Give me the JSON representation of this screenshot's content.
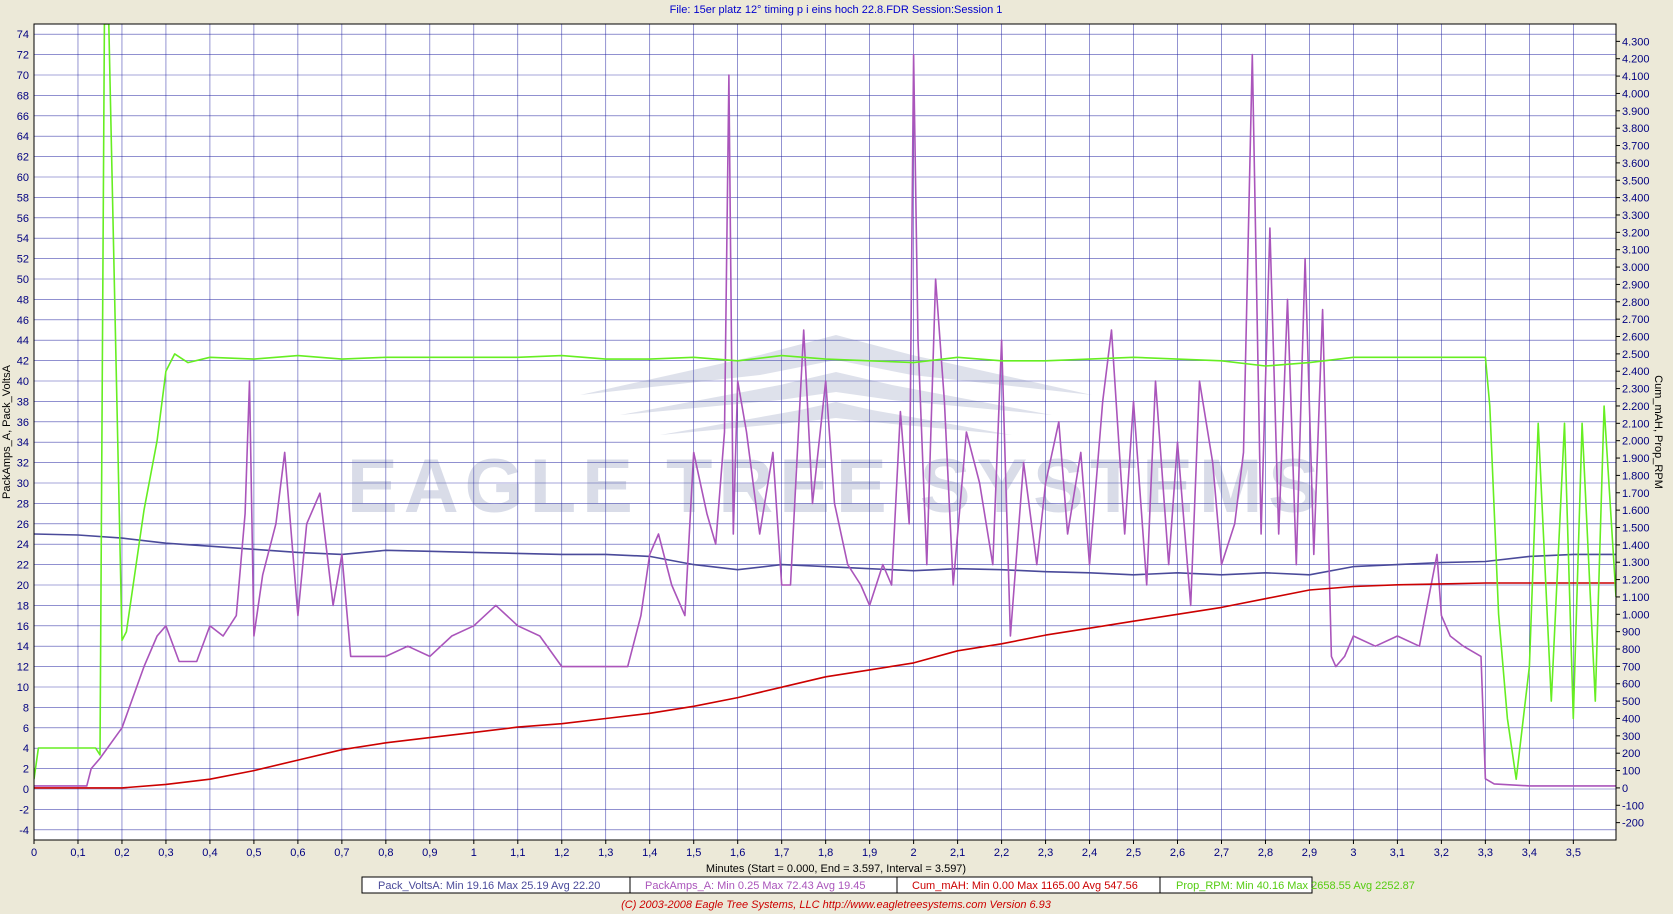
{
  "chart_data": {
    "type": "line",
    "title": "File: 15er platz 12° timing p i eins hoch 22.8.FDR   Session:Session 1",
    "xlabel": "Minutes (Start = 0.000,  End = 3.597,  Interval =  3.597)",
    "ylabel_left": "PackAmps_A, Pack_VoltsA",
    "ylabel_right": "Cum_mAH, Prop_RPM",
    "xlim": [
      0,
      3.597
    ],
    "ylim_left": [
      -5,
      75
    ],
    "ylim_right": [
      -300,
      4400
    ],
    "x_ticks": [
      0,
      0.1,
      0.2,
      0.3,
      0.4,
      0.5,
      0.6,
      0.7,
      0.8,
      0.9,
      1,
      1.1,
      1.2,
      1.3,
      1.4,
      1.5,
      1.6,
      1.7,
      1.8,
      1.9,
      2,
      2.1,
      2.2,
      2.3,
      2.4,
      2.5,
      2.6,
      2.7,
      2.8,
      2.9,
      3,
      3.1,
      3.2,
      3.3,
      3.4,
      3.5
    ],
    "x_tick_labels": [
      "0",
      "0,1",
      "0,2",
      "0,3",
      "0,4",
      "0,5",
      "0,6",
      "0,7",
      "0,8",
      "0,9",
      "1",
      "1,1",
      "1,2",
      "1,3",
      "1,4",
      "1,5",
      "1,6",
      "1,7",
      "1,8",
      "1,9",
      "2",
      "2,1",
      "2,2",
      "2,3",
      "2,4",
      "2,5",
      "2,6",
      "2,7",
      "2,8",
      "2,9",
      "3",
      "3,1",
      "3,2",
      "3,3",
      "3,4",
      "3,5"
    ],
    "y_left_ticks": [
      -4,
      -2,
      0,
      2,
      4,
      6,
      8,
      10,
      12,
      14,
      16,
      18,
      20,
      22,
      24,
      26,
      28,
      30,
      32,
      34,
      36,
      38,
      40,
      42,
      44,
      46,
      48,
      50,
      52,
      54,
      56,
      58,
      60,
      62,
      64,
      66,
      68,
      70,
      72,
      74
    ],
    "y_right_ticks": [
      -200,
      -100,
      0,
      100,
      200,
      300,
      400,
      500,
      600,
      700,
      800,
      900,
      1000,
      1100,
      1200,
      1300,
      1400,
      1500,
      1600,
      1700,
      1800,
      1900,
      2000,
      2100,
      2200,
      2300,
      2400,
      2500,
      2600,
      2700,
      2800,
      2900,
      3000,
      3100,
      3200,
      3300,
      3400,
      3500,
      3600,
      3700,
      3800,
      3900,
      4000,
      4100,
      4200,
      4300
    ],
    "y_right_tick_labels": [
      "-200",
      "-100",
      "0",
      "100",
      "200",
      "300",
      "400",
      "500",
      "600",
      "700",
      "800",
      "900",
      "1.000",
      "1.100",
      "1.200",
      "1.300",
      "1.400",
      "1.500",
      "1.600",
      "1.700",
      "1.800",
      "1.900",
      "2.000",
      "2.100",
      "2.200",
      "2.300",
      "2.400",
      "2.500",
      "2.600",
      "2.700",
      "2.800",
      "2.900",
      "3.000",
      "3.100",
      "3.200",
      "3.300",
      "3.400",
      "3.500",
      "3.600",
      "3.700",
      "3.800",
      "3.900",
      "4.000",
      "4.100",
      "4.200",
      "4.300"
    ],
    "grid": true,
    "series": [
      {
        "name": "Pack_VoltsA",
        "axis": "left",
        "color": "#4a4a9a",
        "x": [
          0,
          0.1,
          0.2,
          0.3,
          0.4,
          0.5,
          0.6,
          0.7,
          0.8,
          0.9,
          1.0,
          1.1,
          1.2,
          1.3,
          1.4,
          1.5,
          1.6,
          1.7,
          1.8,
          1.9,
          2.0,
          2.1,
          2.2,
          2.3,
          2.4,
          2.5,
          2.6,
          2.7,
          2.8,
          2.9,
          3.0,
          3.1,
          3.2,
          3.3,
          3.4,
          3.5,
          3.597
        ],
        "y": [
          25.0,
          24.9,
          24.6,
          24.1,
          23.8,
          23.5,
          23.2,
          23.0,
          23.4,
          23.3,
          23.2,
          23.1,
          23.0,
          23.0,
          22.8,
          22.0,
          21.5,
          22.0,
          21.8,
          21.6,
          21.4,
          21.6,
          21.5,
          21.3,
          21.2,
          21.0,
          21.2,
          21.0,
          21.2,
          21.0,
          21.8,
          22.0,
          22.2,
          22.3,
          22.8,
          23.0,
          23.0
        ]
      },
      {
        "name": "PackAmps_A",
        "axis": "left",
        "color": "#aa55bb",
        "x": [
          0,
          0.12,
          0.13,
          0.15,
          0.2,
          0.25,
          0.28,
          0.3,
          0.33,
          0.37,
          0.4,
          0.43,
          0.46,
          0.48,
          0.49,
          0.5,
          0.52,
          0.55,
          0.57,
          0.6,
          0.62,
          0.65,
          0.68,
          0.7,
          0.72,
          0.75,
          0.8,
          0.85,
          0.9,
          0.95,
          1.0,
          1.05,
          1.1,
          1.15,
          1.2,
          1.25,
          1.3,
          1.35,
          1.38,
          1.4,
          1.42,
          1.45,
          1.48,
          1.5,
          1.53,
          1.55,
          1.57,
          1.58,
          1.59,
          1.6,
          1.62,
          1.65,
          1.68,
          1.7,
          1.72,
          1.75,
          1.77,
          1.8,
          1.82,
          1.85,
          1.88,
          1.9,
          1.93,
          1.95,
          1.97,
          1.99,
          2.0,
          2.01,
          2.03,
          2.05,
          2.07,
          2.09,
          2.12,
          2.15,
          2.18,
          2.2,
          2.22,
          2.25,
          2.28,
          2.3,
          2.33,
          2.35,
          2.38,
          2.4,
          2.43,
          2.45,
          2.48,
          2.5,
          2.53,
          2.55,
          2.58,
          2.6,
          2.63,
          2.65,
          2.68,
          2.7,
          2.73,
          2.75,
          2.77,
          2.79,
          2.81,
          2.83,
          2.85,
          2.87,
          2.89,
          2.91,
          2.93,
          2.95,
          2.96,
          2.98,
          3.0,
          3.05,
          3.1,
          3.15,
          3.19,
          3.2,
          3.22,
          3.25,
          3.29,
          3.3,
          3.32,
          3.4,
          3.5,
          3.597
        ],
        "y": [
          0.3,
          0.3,
          2,
          3,
          6,
          12,
          15,
          16,
          12.5,
          12.5,
          16,
          15,
          17,
          27,
          40,
          15,
          21,
          26,
          33,
          17,
          26,
          29,
          18,
          23,
          13,
          13,
          13,
          14,
          13,
          15,
          16,
          18,
          16,
          15,
          12,
          12,
          12,
          12,
          17,
          23,
          25,
          20,
          17,
          33,
          27,
          24,
          35,
          70,
          25,
          40,
          35,
          25,
          33,
          20,
          20,
          45,
          28,
          40,
          28,
          22,
          20,
          18,
          22,
          20,
          37,
          26,
          72,
          44,
          22,
          50,
          38,
          20,
          35,
          30,
          22,
          44,
          15,
          32,
          22,
          30,
          36,
          25,
          33,
          22,
          38,
          45,
          25,
          38,
          20,
          40,
          22,
          34,
          18,
          40,
          32,
          22,
          26,
          33,
          72,
          25,
          55,
          25,
          48,
          22,
          52,
          23,
          47,
          13,
          12,
          13,
          15,
          14,
          15,
          14,
          23,
          17,
          15,
          14,
          13,
          1,
          0.5,
          0.3,
          0.3,
          0.3
        ]
      },
      {
        "name": "Cum_mAH",
        "axis": "right",
        "color": "#cc0000",
        "x": [
          0,
          0.2,
          0.3,
          0.4,
          0.5,
          0.6,
          0.7,
          0.8,
          0.9,
          1.0,
          1.1,
          1.2,
          1.3,
          1.4,
          1.5,
          1.6,
          1.7,
          1.8,
          1.9,
          2.0,
          2.1,
          2.2,
          2.3,
          2.4,
          2.5,
          2.6,
          2.7,
          2.8,
          2.9,
          3.0,
          3.1,
          3.2,
          3.3,
          3.4,
          3.5,
          3.597
        ],
        "y": [
          0,
          0,
          20,
          50,
          100,
          160,
          220,
          260,
          290,
          320,
          350,
          370,
          400,
          430,
          470,
          520,
          580,
          640,
          680,
          720,
          790,
          830,
          880,
          920,
          960,
          1000,
          1040,
          1090,
          1140,
          1160,
          1170,
          1175,
          1180,
          1180,
          1180,
          1180
        ]
      },
      {
        "name": "Prop_RPM",
        "axis": "right",
        "color": "#66ee22",
        "x": [
          0,
          0.01,
          0.14,
          0.15,
          0.16,
          0.17,
          0.2,
          0.21,
          0.25,
          0.28,
          0.3,
          0.32,
          0.35,
          0.4,
          0.5,
          0.6,
          0.7,
          0.8,
          0.9,
          1.0,
          1.1,
          1.2,
          1.3,
          1.4,
          1.5,
          1.6,
          1.7,
          1.8,
          1.9,
          2.0,
          2.1,
          2.2,
          2.3,
          2.4,
          2.5,
          2.6,
          2.7,
          2.8,
          2.9,
          3.0,
          3.1,
          3.2,
          3.3,
          3.31,
          3.33,
          3.35,
          3.37,
          3.4,
          3.42,
          3.45,
          3.48,
          3.5,
          3.52,
          3.55,
          3.57,
          3.597
        ],
        "y": [
          50,
          230,
          230,
          190,
          4400,
          4400,
          850,
          900,
          1600,
          2000,
          2400,
          2500,
          2450,
          2480,
          2470,
          2490,
          2470,
          2480,
          2480,
          2480,
          2480,
          2490,
          2470,
          2470,
          2480,
          2460,
          2490,
          2470,
          2460,
          2450,
          2480,
          2460,
          2460,
          2470,
          2480,
          2470,
          2460,
          2430,
          2450,
          2480,
          2480,
          2480,
          2480,
          2200,
          1000,
          400,
          50,
          700,
          2100,
          500,
          2100,
          400,
          2100,
          500,
          2200,
          1100
        ]
      }
    ],
    "legend": {
      "placement": "bottom",
      "entries": [
        {
          "series": "Pack_VoltsA",
          "text": "Pack_VoltsA:  Min 19.16   Max 25.19   Avg 22.20",
          "color": "#4a4a9a"
        },
        {
          "series": "PackAmps_A",
          "text": "PackAmps_A:  Min 0.25   Max 72.43   Avg 19.45",
          "color": "#aa55bb"
        },
        {
          "series": "Cum_mAH",
          "text": "Cum_mAH:  Min 0.00   Max 1165.00   Avg 547.56",
          "color": "#cc0000"
        },
        {
          "series": "Prop_RPM",
          "text": "Prop_RPM:  Min 40.16   Max 2658.55   Avg 2252.87",
          "color": "#55cc11"
        }
      ]
    },
    "watermark_text": "EAGLE TREE SYSTEMS",
    "footer": "(C) 2003-2008 Eagle Tree Systems, LLC      http://www.eagletreesystems.com     Version 6.93",
    "colors": {
      "background": "#ece9d8",
      "plot_background": "#ffffff",
      "grid": "#2020a0",
      "tick_text": "#000080",
      "title_text": "#0000cc",
      "footer_text": "#cc0000"
    }
  }
}
